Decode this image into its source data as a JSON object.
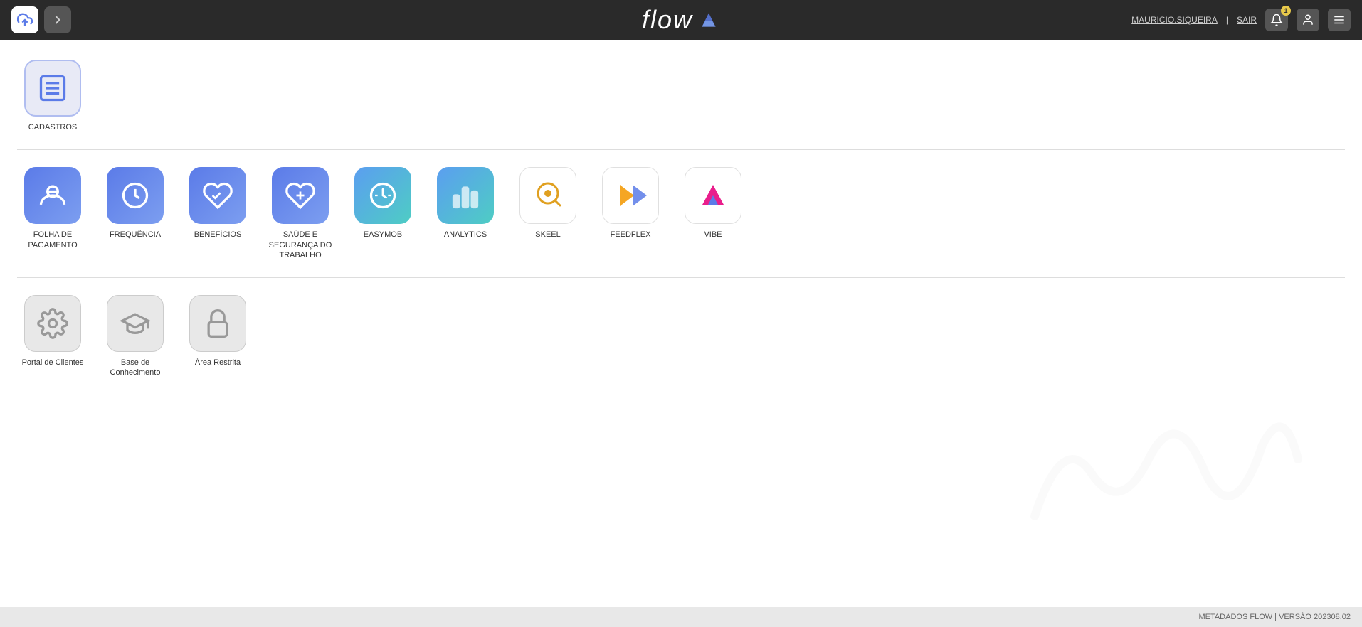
{
  "header": {
    "logo": "flow",
    "user_label": "MAURICIO.SIQUEIRA",
    "separator": "|",
    "sair_label": "SAIR",
    "notification_count": "1"
  },
  "sections": {
    "cadastros": {
      "label": "CADASTROS"
    },
    "apps": {
      "items": [
        {
          "id": "folha",
          "label": "FOLHA DE\nPAGAMENTO",
          "colorClass": "icon-folha"
        },
        {
          "id": "frequencia",
          "label": "FREQUÊNCIA",
          "colorClass": "icon-frequencia"
        },
        {
          "id": "beneficios",
          "label": "BENEFÍCIOS",
          "colorClass": "icon-beneficios"
        },
        {
          "id": "saude",
          "label": "SAÚDE E\nSEGURANÇA DO\nTRABALHO",
          "colorClass": "icon-saude"
        },
        {
          "id": "easymob",
          "label": "EASYMOB",
          "colorClass": "icon-easymob"
        },
        {
          "id": "analytics",
          "label": "ANALYTICS",
          "colorClass": "icon-analytics"
        },
        {
          "id": "skeel",
          "label": "SKEEL",
          "colorClass": "icon-skeel"
        },
        {
          "id": "feedflex",
          "label": "FEEDFLEX",
          "colorClass": "icon-feedflex"
        },
        {
          "id": "vibe",
          "label": "VIBE",
          "colorClass": "icon-vibe"
        }
      ]
    },
    "others": {
      "items": [
        {
          "id": "portal",
          "label": "Portal de Clientes",
          "colorClass": "icon-portal"
        },
        {
          "id": "base",
          "label": "Base de\nConhecimento",
          "colorClass": "icon-base"
        },
        {
          "id": "restrita",
          "label": "Área Restrita",
          "colorClass": "icon-restrita"
        }
      ]
    }
  },
  "footer": {
    "text": "METADADOS FLOW | VERSÃO 202308.02"
  }
}
